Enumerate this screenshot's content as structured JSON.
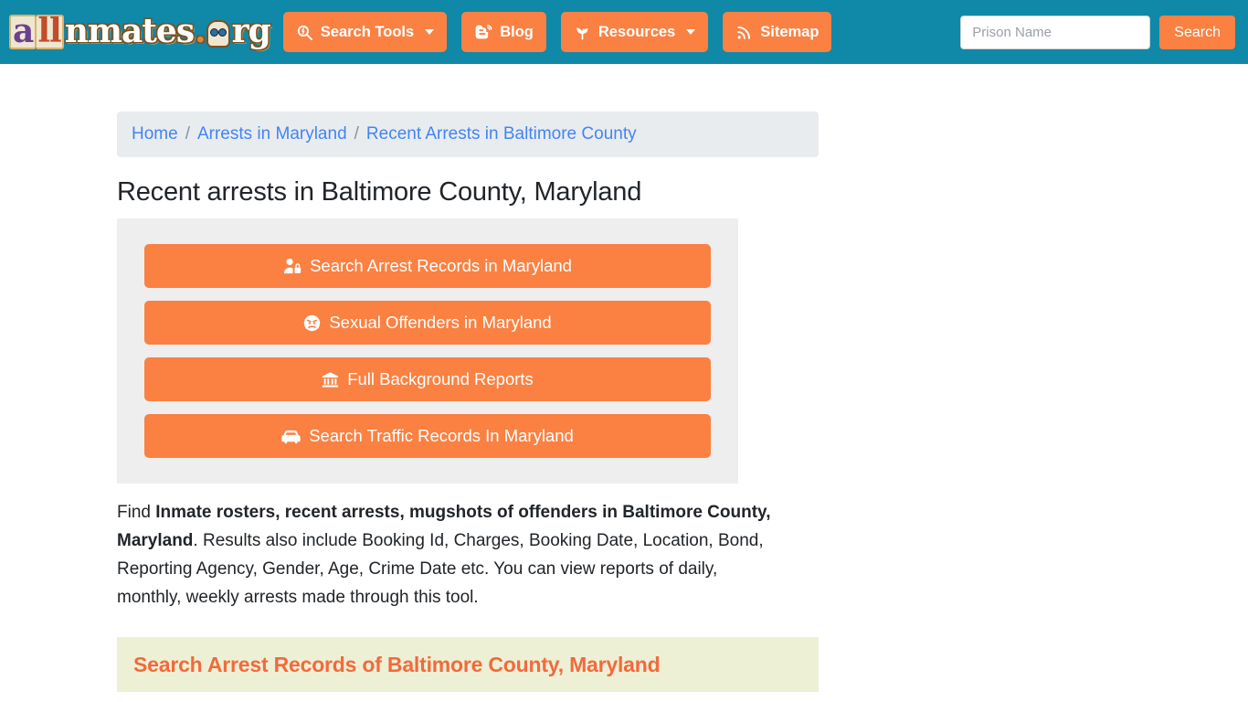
{
  "header": {
    "logo": {
      "part_a": "a",
      "part_ll": "ll",
      "part_mid": "nmates",
      "dot": ".",
      "part_end": "rg",
      "full_text": "allinmates.org"
    },
    "nav": [
      {
        "label": "Search Tools",
        "icon": "search-icon",
        "has_caret": true
      },
      {
        "label": "Blog",
        "icon": "blogger-icon",
        "has_caret": false
      },
      {
        "label": "Resources",
        "icon": "seedling-icon",
        "has_caret": true
      },
      {
        "label": "Sitemap",
        "icon": "rss-icon",
        "has_caret": false
      }
    ],
    "search": {
      "placeholder": "Prison Name",
      "value": "",
      "button_label": "Search"
    },
    "colors": {
      "header_bg": "#1088a8",
      "accent_orange": "#fa8142"
    }
  },
  "breadcrumb": {
    "items": [
      {
        "label": "Home"
      },
      {
        "label": "Arrests in Maryland"
      },
      {
        "label": "Recent Arrests in Baltimore County"
      }
    ],
    "separator": "/"
  },
  "main": {
    "title": "Recent arrests in Baltimore County, Maryland",
    "action_buttons": [
      {
        "label": "Search Arrest Records in Maryland",
        "icon": "user-lock-icon"
      },
      {
        "label": "Sexual Offenders in Maryland",
        "icon": "angry-face-icon"
      },
      {
        "label": "Full Background Reports",
        "icon": "landmark-icon"
      },
      {
        "label": "Search Traffic Records In Maryland",
        "icon": "car-icon"
      }
    ],
    "paragraph": {
      "lead": "Find ",
      "bold": "Inmate rosters, recent arrests, mugshots of offenders in Baltimore County, Maryland",
      "rest": ". Results also include Booking Id, Charges, Booking Date, Location, Bond, Reporting Agency, Gender, Age, Crime Date etc. You can view reports of daily, monthly, weekly arrests made through this tool."
    },
    "section_heading": "Search Arrest Records of Baltimore County, Maryland"
  }
}
